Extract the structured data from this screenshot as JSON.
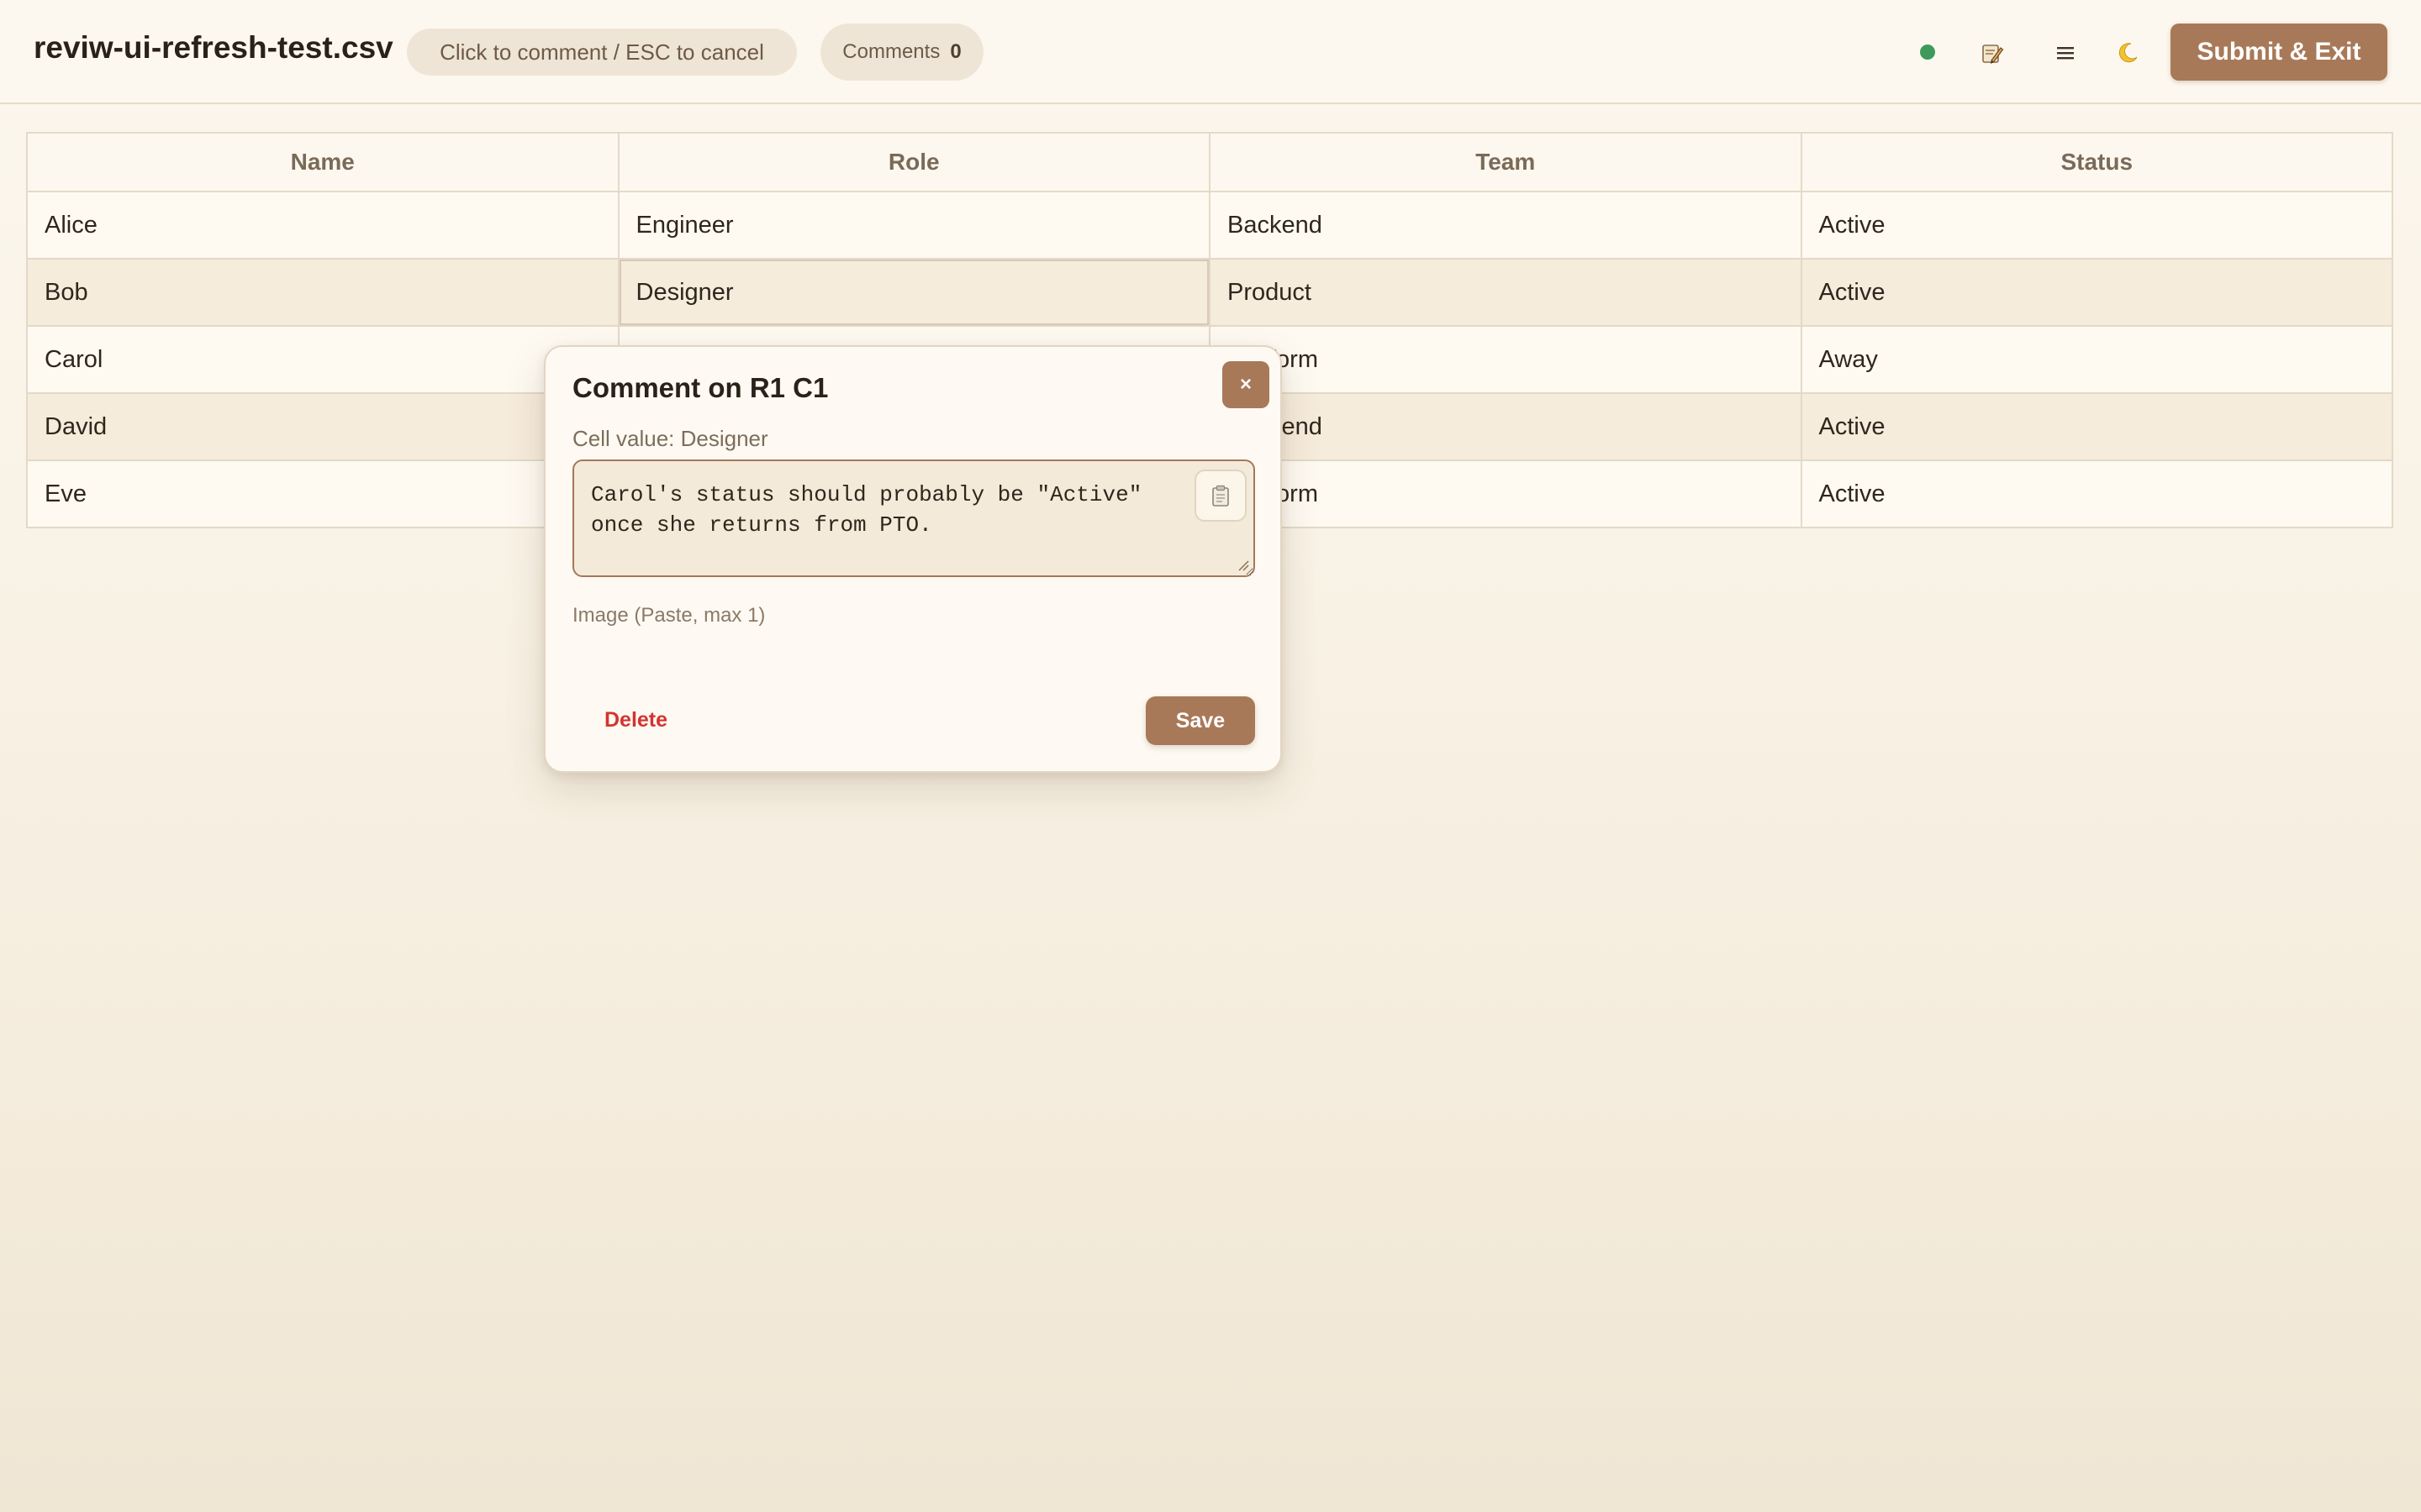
{
  "header": {
    "file_title": "reviw-ui-refresh-test.csv",
    "mode_hint": "Click to comment / ESC to cancel",
    "comments_label": "Comments",
    "comments_count": "0",
    "status_dot_color": "#3e9a5a",
    "icons": [
      "edit-note-icon",
      "menu-icon",
      "moon-icon"
    ],
    "submit_label": "Submit & Exit"
  },
  "table": {
    "columns": [
      "Name",
      "Role",
      "Team",
      "Status"
    ],
    "rows": [
      [
        "Alice",
        "Engineer",
        "Backend",
        "Active"
      ],
      [
        "Bob",
        "Designer",
        "Product",
        "Active"
      ],
      [
        "Carol",
        "",
        "Platform",
        "Away"
      ],
      [
        "David",
        "",
        "Backend",
        "Active"
      ],
      [
        "Eve",
        "",
        "Platform",
        "Active"
      ]
    ]
  },
  "modal": {
    "title": "Comment on R1 C1",
    "cell_value": "Cell value: Designer",
    "comment_text": "Carol's status should probably be \"Active\" once she returns from PTO.",
    "image_hint": "Image (Paste, max 1)",
    "close_label": "×",
    "delete_label": "Delete",
    "save_label": "Save"
  },
  "colors": {
    "accent": "#a87958",
    "danger": "#d4342f",
    "background": "#fcf7ee"
  }
}
